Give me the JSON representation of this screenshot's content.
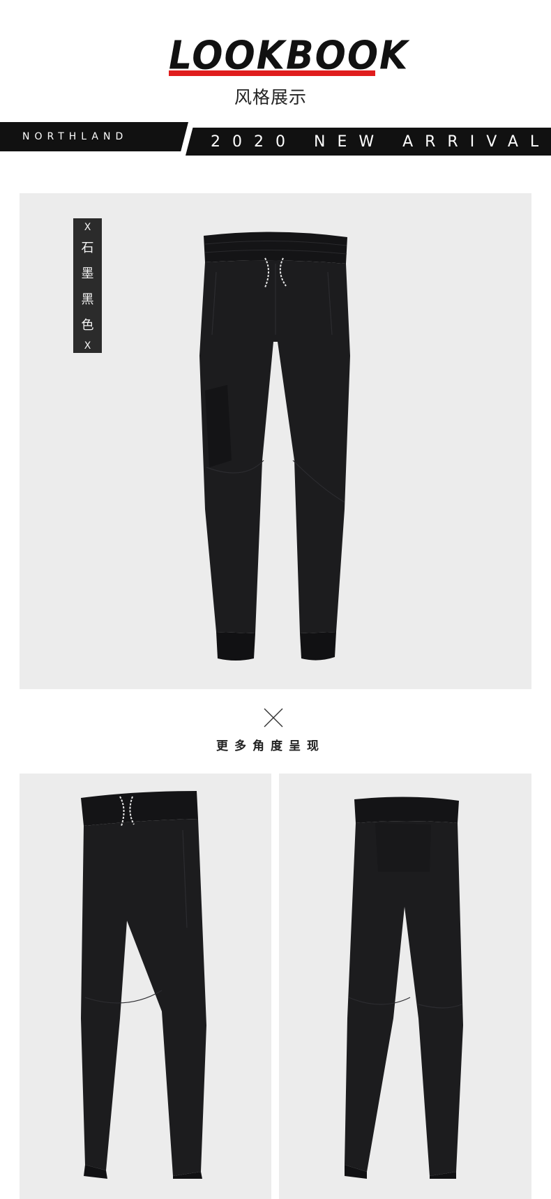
{
  "header": {
    "title": "LOOKBOOK",
    "subtitle": "风格展示",
    "accent_color": "#e01d1d"
  },
  "band": {
    "brand": "NORTHLAND",
    "arrival": "2020 NEW ARRIVAL"
  },
  "color_tag": {
    "mark_top": "X",
    "chars": [
      "石",
      "墨",
      "黑",
      "色"
    ],
    "mark_bottom": "X"
  },
  "section": {
    "more_angles": "更多角度呈现"
  },
  "colors": {
    "photo_bg": "#ececec",
    "garment": "#1c1c1e",
    "band": "#111111"
  }
}
